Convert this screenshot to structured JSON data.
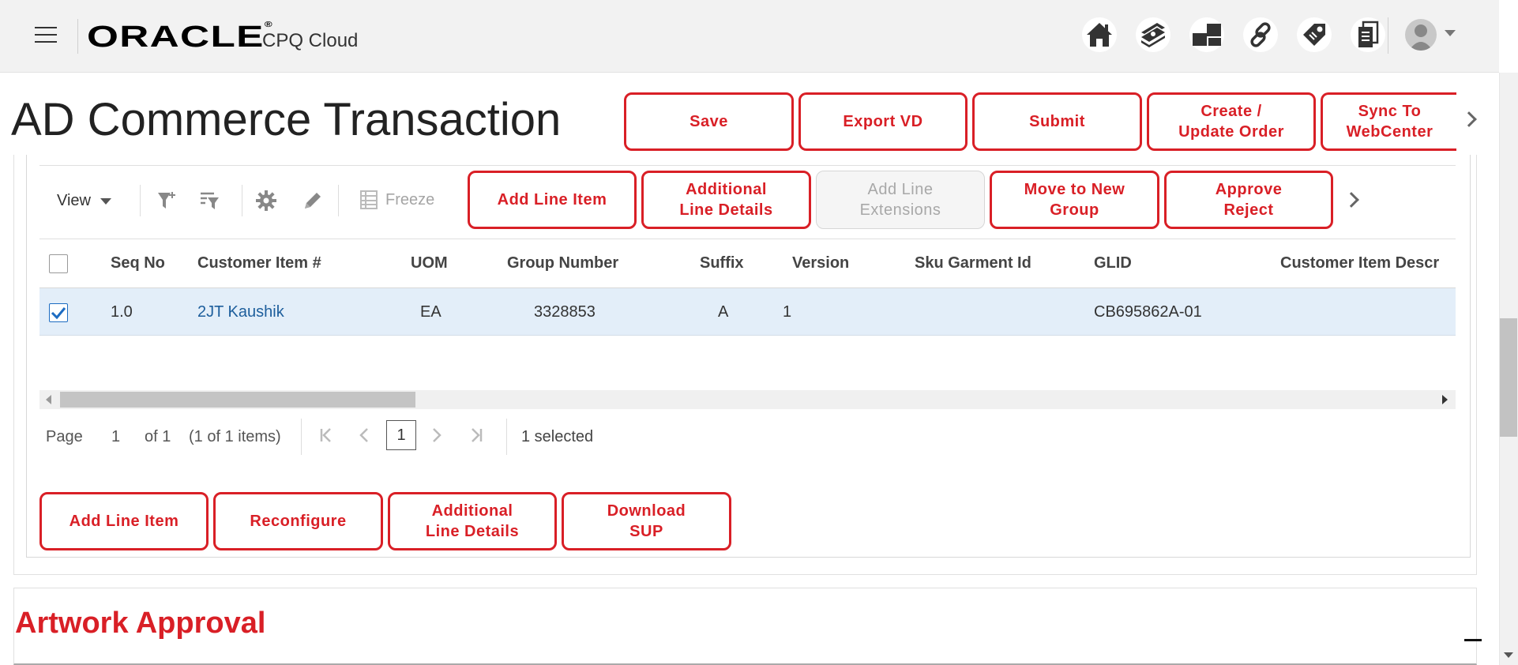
{
  "header": {
    "logo": "ORACLE",
    "logo_mark": "®",
    "product": "CPQ Cloud",
    "icons": [
      "home-icon",
      "money-icon",
      "blocks-icon",
      "link-icon",
      "tag-icon",
      "documents-icon"
    ]
  },
  "page": {
    "title": "AD Commerce Transaction",
    "actions": [
      "Save",
      "Export VD",
      "Submit",
      "Create /\nUpdate Order",
      "Sync To\nWebCenter"
    ]
  },
  "toolbar": {
    "view_label": "View",
    "freeze_label": "Freeze",
    "buttons": [
      "Add Line Item",
      "Additional\nLine Details",
      "Add Line\nExtensions",
      "Move to New\nGroup",
      "Approve\nReject"
    ]
  },
  "table": {
    "columns": [
      "Seq No",
      "Customer Item #",
      "UOM",
      "Group Number",
      "Suffix",
      "Version",
      "Sku Garment Id",
      "GLID",
      "Customer Item Descr"
    ],
    "rows": [
      {
        "selected": true,
        "seq_no": "1.0",
        "customer_item": "2JT Kaushik",
        "uom": "EA",
        "group_number": "3328853",
        "suffix": "A",
        "version": "1",
        "sku_garment_id": "",
        "glid": "CB695862A-01",
        "customer_item_descr": ""
      }
    ]
  },
  "pagination": {
    "page_label": "Page",
    "current_page": "1",
    "of_label": "of 1",
    "items_label": "(1 of 1 items)",
    "page_input": "1",
    "selected_label": "1 selected"
  },
  "bottom_buttons": [
    "Add Line Item",
    "Reconfigure",
    "Additional\nLine Details",
    "Download\nSUP"
  ],
  "artwork": {
    "title": "Artwork Approval"
  },
  "colors": {
    "accent": "#d91f26",
    "link": "#1d5e9c",
    "selected_row": "#e3eef9"
  }
}
